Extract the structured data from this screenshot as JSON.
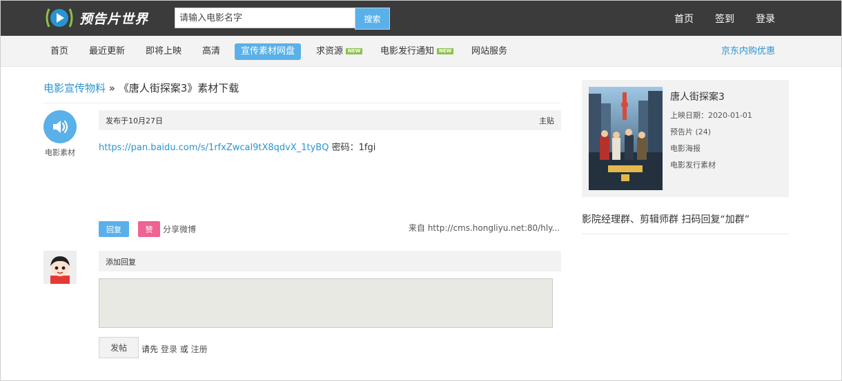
{
  "header": {
    "logo_text": "预告片世界",
    "search": {
      "placeholder": "请输入电影名字",
      "button": "搜索"
    },
    "links": [
      "首页",
      "签到",
      "登录"
    ]
  },
  "nav": {
    "items": [
      {
        "label": "首页"
      },
      {
        "label": "最近更新"
      },
      {
        "label": "即将上映"
      },
      {
        "label": "高清"
      },
      {
        "label": "宣传素材网盘",
        "active": true
      },
      {
        "label": "求资源",
        "badge": "NEW"
      },
      {
        "label": "电影发行通知",
        "badge": "NEW"
      },
      {
        "label": "网站服务"
      }
    ],
    "right_link": "京东内购优惠"
  },
  "breadcrumb": {
    "link": "电影宣传物料",
    "separator": "»",
    "current": "《唐人街探案3》素材下载"
  },
  "post": {
    "author": "电影素材",
    "date": "发布于10月27日",
    "tag": "主贴",
    "link_url": "https://pan.baidu.com/s/1rfxZwcal9tX8qdvX_1tyBQ",
    "password_label": "密码：",
    "password": "1fgi",
    "reply_button": "回复",
    "like_button": "赞",
    "share": "分享微博",
    "source": "来自 http://cms.hongliyu.net:80/hly..."
  },
  "reply": {
    "title": "添加回复",
    "submit": "发帖",
    "hint_prefix": "请先",
    "login": "登录",
    "or": "或",
    "register": "注册"
  },
  "sidebar": {
    "movie": {
      "title": "唐人街探案3",
      "release": "上映日期：2020-01-01",
      "trailer": "预告片 (24)",
      "poster": "电影海报",
      "material": "电影发行素材"
    },
    "group_text": "影院经理群、剪辑师群 扫码回复“加群”"
  },
  "colors": {
    "topbar": "#3b3b3b",
    "accent": "#5ab0e8",
    "link": "#2a94d0",
    "like": "#f06292",
    "new_badge": "#8bc34a"
  }
}
